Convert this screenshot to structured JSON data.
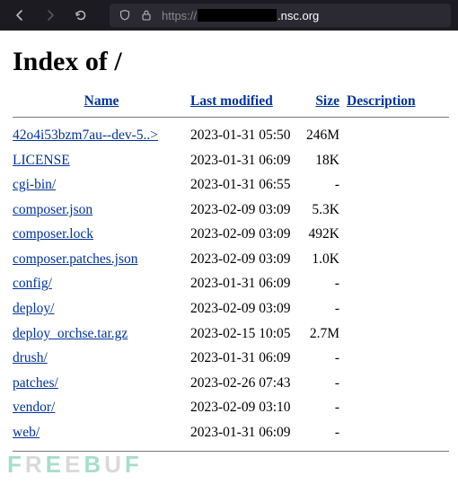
{
  "url": {
    "protocol": "https://",
    "host_suffix": ".nsc.org"
  },
  "page": {
    "heading": "Index of /"
  },
  "headers": {
    "name": "Name",
    "modified": "Last modified",
    "size": "Size",
    "description": "Description"
  },
  "files": [
    {
      "name": "42o4i53bzm7au--dev-5..>",
      "modified": "2023-01-31 05:50",
      "size": "246M"
    },
    {
      "name": "LICENSE",
      "modified": "2023-01-31 06:09",
      "size": "18K"
    },
    {
      "name": "cgi-bin/",
      "modified": "2023-01-31 06:55",
      "size": "-"
    },
    {
      "name": "composer.json",
      "modified": "2023-02-09 03:09",
      "size": "5.3K"
    },
    {
      "name": "composer.lock",
      "modified": "2023-02-09 03:09",
      "size": "492K"
    },
    {
      "name": "composer.patches.json",
      "modified": "2023-02-09 03:09",
      "size": "1.0K"
    },
    {
      "name": "config/",
      "modified": "2023-01-31 06:09",
      "size": "-"
    },
    {
      "name": "deploy/",
      "modified": "2023-02-09 03:09",
      "size": "-"
    },
    {
      "name": "deploy_orchse.tar.gz",
      "modified": "2023-02-15 10:05",
      "size": "2.7M"
    },
    {
      "name": "drush/",
      "modified": "2023-01-31 06:09",
      "size": "-"
    },
    {
      "name": "patches/",
      "modified": "2023-02-26 07:43",
      "size": "-"
    },
    {
      "name": "vendor/",
      "modified": "2023-02-09 03:10",
      "size": "-"
    },
    {
      "name": "web/",
      "modified": "2023-01-31 06:09",
      "size": "-"
    }
  ],
  "watermark": "FREEBUF"
}
